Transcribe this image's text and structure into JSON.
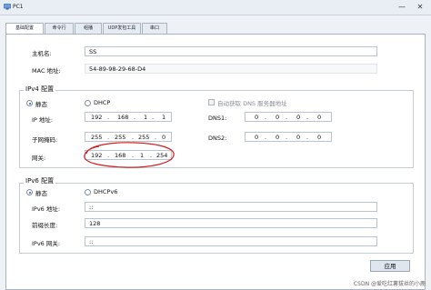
{
  "window": {
    "title": "PC1",
    "minimize": "—",
    "close": "✕"
  },
  "tabs": [
    "基础配置",
    "命令行",
    "组播",
    "UDP发包工具",
    "串口"
  ],
  "basic": {
    "hostname_label": "主机名:",
    "hostname_value": "SS",
    "mac_label": "MAC 地址:",
    "mac_value": "54-89-98-29-68-D4"
  },
  "ipv4": {
    "title": "IPv4 配置",
    "static_label": "静态",
    "dhcp_label": "DHCP",
    "mode": "static",
    "auto_dns_label": "自动获取 DNS 服务器地址",
    "ip_label": "IP 地址:",
    "ip": [
      "192",
      "168",
      "1",
      "1"
    ],
    "mask_label": "子网掩码:",
    "mask": [
      "255",
      "255",
      "255",
      "0"
    ],
    "gateway_label": "网关:",
    "gateway": [
      "192",
      "168",
      "1",
      "254"
    ],
    "dns1_label": "DNS1:",
    "dns1": [
      "0",
      "0",
      "0",
      "0"
    ],
    "dns2_label": "DNS2:",
    "dns2": [
      "0",
      "0",
      "0",
      "0"
    ]
  },
  "ipv6": {
    "title": "IPv6 配置",
    "static_label": "静态",
    "dhcp_label": "DHCPv6",
    "mode": "static",
    "ip_label": "IPv6 地址:",
    "ip_value": "::",
    "prefix_label": "前缀长度:",
    "prefix_value": "128",
    "gateway_label": "IPv6 网关:",
    "gateway_value": "::"
  },
  "apply_label": "应用",
  "watermark": "CSDN @爱吃红薯拔丝的小鹿",
  "colors": {
    "annotation": "#d42020",
    "accent": "#1b5fd0"
  }
}
